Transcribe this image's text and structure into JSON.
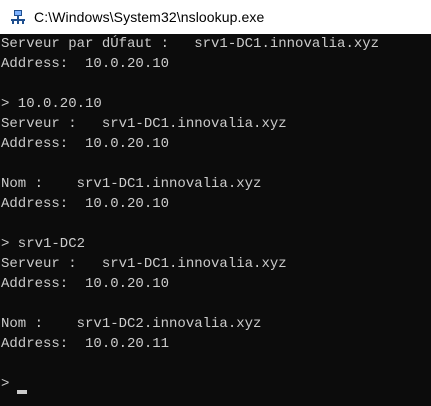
{
  "window": {
    "title": "C:\\Windows\\System32\\nslookup.exe",
    "icon": "nslookup-app-icon"
  },
  "console": {
    "lines": [
      "Serveur par dÚfaut :   srv1-DC1.innovalia.xyz",
      "Address:  10.0.20.10",
      "",
      "> 10.0.20.10",
      "Serveur :   srv1-DC1.innovalia.xyz",
      "Address:  10.0.20.10",
      "",
      "Nom :    srv1-DC1.innovalia.xyz",
      "Address:  10.0.20.10",
      "",
      "> srv1-DC2",
      "Serveur :   srv1-DC1.innovalia.xyz",
      "Address:  10.0.20.10",
      "",
      "Nom :    srv1-DC2.innovalia.xyz",
      "Address:  10.0.20.11",
      "",
      "> "
    ]
  },
  "colors": {
    "background": "#0c0c0c",
    "text": "#cccccc",
    "titlebar": "#ffffff"
  }
}
